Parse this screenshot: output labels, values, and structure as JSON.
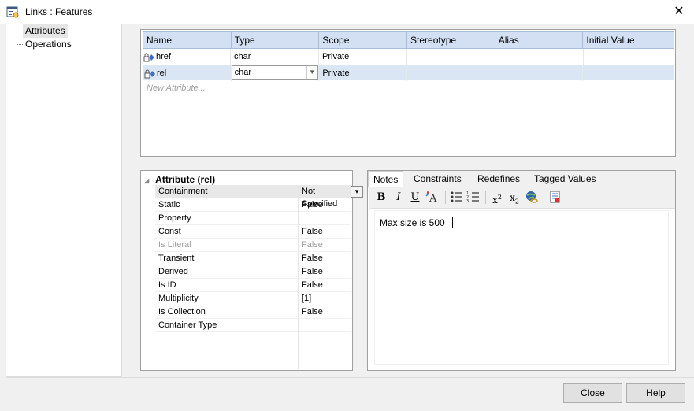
{
  "window": {
    "title": "Links : Features",
    "close_glyph": "✕",
    "icon": "properties-window-icon"
  },
  "tree": {
    "items": [
      {
        "label": "Attributes",
        "selected": true
      },
      {
        "label": "Operations",
        "selected": false
      }
    ]
  },
  "grid": {
    "columns": [
      "Name",
      "Type",
      "Scope",
      "Stereotype",
      "Alias",
      "Initial Value"
    ],
    "rows": [
      {
        "name": "href",
        "type": "char",
        "scope": "Private",
        "stereotype": "",
        "alias": "",
        "initial_value": "",
        "selected": false
      },
      {
        "name": "rel",
        "type": "char",
        "scope": "Private",
        "stereotype": "",
        "alias": "",
        "initial_value": "",
        "selected": true
      }
    ],
    "new_placeholder": "New Attribute..."
  },
  "properties": {
    "heading": "Attribute (rel)",
    "rows": [
      {
        "name": "Containment",
        "value": "Not Specified"
      },
      {
        "name": "Static",
        "value": "False"
      },
      {
        "name": "Property",
        "value": ""
      },
      {
        "name": "Const",
        "value": "False"
      },
      {
        "name": "Is Literal",
        "value": "False"
      },
      {
        "name": "Transient",
        "value": "False"
      },
      {
        "name": "Derived",
        "value": "False"
      },
      {
        "name": "Is ID",
        "value": "False"
      },
      {
        "name": "Multiplicity",
        "value": "[1]"
      },
      {
        "name": "Is Collection",
        "value": "False"
      },
      {
        "name": "Container Type",
        "value": ""
      }
    ]
  },
  "notes": {
    "tabs": [
      "Notes",
      "Constraints",
      "Redefines",
      "Tagged Values"
    ],
    "active_tab": "Notes",
    "text": "Max size is 500",
    "toolbar": {
      "bold": "B",
      "italic": "I",
      "underline": "U",
      "superscript_base": "x",
      "superscript_exp": "2",
      "subscript_base": "x",
      "subscript_exp": "2"
    }
  },
  "buttons": {
    "close": "Close",
    "help": "Help"
  },
  "colors": {
    "header_bg": "#d3e0f3",
    "selected_row_bg": "#dbe6f5",
    "disabled_text": "#a0a0a0"
  }
}
